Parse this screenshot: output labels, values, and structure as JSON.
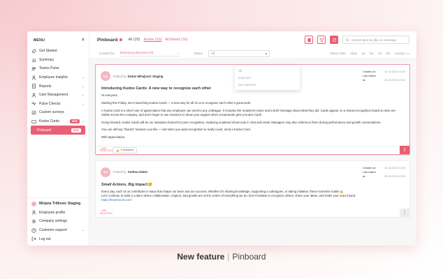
{
  "sidebar": {
    "menu_title": "MENU",
    "items": [
      {
        "label": "Get Started"
      },
      {
        "label": "Summary"
      },
      {
        "label": "Teams Pulse"
      },
      {
        "label": "Employee Insights"
      },
      {
        "label": "Reports"
      },
      {
        "label": "User Management"
      },
      {
        "label": "Pulse Checks"
      },
      {
        "label": "Custom surveys"
      },
      {
        "label": "Kudos Cards",
        "badge": "NEW"
      },
      {
        "label": "Pinboard",
        "badge": "NEW"
      }
    ],
    "user_name": "Mirjana Trifkovic Staging",
    "bottom_items": [
      {
        "label": "Employee profile"
      },
      {
        "label": "Company settings"
      },
      {
        "label": "Customer support"
      },
      {
        "label": "Log out"
      }
    ]
  },
  "header": {
    "title": "Pinboard",
    "tab_all": "All (26)",
    "tab_active": "Active (10)",
    "tab_archived": "Archived (16)",
    "search_placeholder": "Search pins by title or message"
  },
  "filters": {
    "created_by_label": "Created by",
    "created_by_value": "Selected portal users (0)",
    "status_label": "Status",
    "status_value": "All",
    "status_options": [
      "All",
      "Important",
      "Not important"
    ],
    "date_label": "Select Date",
    "date_options": [
      "Clear",
      "1w",
      "2w",
      "1m",
      "3m",
      "Custom"
    ]
  },
  "posts": [
    {
      "avatar": "DM",
      "posted_by_label": "Posted by",
      "author": "Dušan Mihajlović Staging",
      "created_label": "Created at:",
      "created": "22.04.2026 16:26",
      "edited_label": "Last edited at:",
      "edited": "23.04.2026 10:02",
      "title": "Introducing Kudos Cards: A new way to recognize each other",
      "paragraphs": [
        "Hi everyone,",
        "Starting this Friday, we're launching Kudos Cards — a new way for all of us to recognize each other's great work.",
        "A Kudos Card is a short note of appreciation that any employee can send to any colleague. It includes the recipient's name and a brief message about what they did. Cards appear on a shared recognition board so wins are visible across the company, and don't forget to use reactions to show your support when a teammate gets a Kudos Card!",
        "Going forward, Kudos Cards will be our standard channel for peer recognition, replacing scattered shout-outs in chat and email. Managers may also reference them during performance and growth conversations.",
        "You can still say \"thanks\" however you like — but when you want recognition to really count, send a Kudos Card.",
        "With appreciation,"
      ],
      "add_label": "ADD REACTION",
      "reactions": "0 reactions"
    },
    {
      "avatar": "AA",
      "posted_by_label": "Posted by",
      "author": "Andrea Admin",
      "created_label": "Created at:",
      "created": "20.04.2026 12:59",
      "edited_label": "Last edited at:",
      "edited": "20.04.2026 12:59",
      "title": "Small Actions, Big Impact😊",
      "paragraphs": [
        "Every day, each of us contributes in ways that shape our team and our success. Whether it's sharing knowledge, supporting a colleagues, or taking initiative, these moments matter👍",
        "Let's continue to build a culture where collaboration, respect, and growth are at the center of everything we do. Don't hesitate to recognize others, share your ideas, and make your voice heard."
      ],
      "link": "https://heartcount.com/",
      "add_label": "ADD REACTION"
    }
  ],
  "caption": {
    "bold": "New feature",
    "rest": "Pinboard"
  },
  "colors": {
    "accent": "#e95f73",
    "background": "#fbe9ea"
  }
}
